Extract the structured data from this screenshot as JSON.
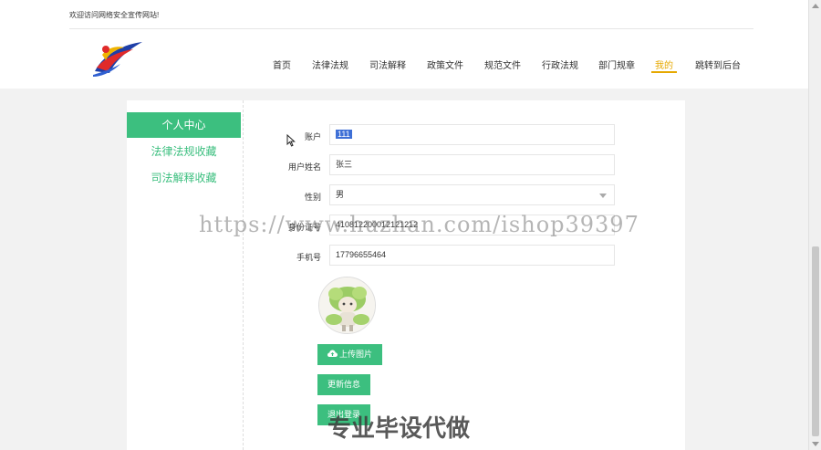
{
  "header": {
    "welcome": "欢迎访问网络安全宣传网站!"
  },
  "nav": {
    "items": [
      {
        "label": "首页"
      },
      {
        "label": "法律法规"
      },
      {
        "label": "司法解释"
      },
      {
        "label": "政策文件"
      },
      {
        "label": "规范文件"
      },
      {
        "label": "行政法规"
      },
      {
        "label": "部门规章"
      },
      {
        "label": "我的"
      },
      {
        "label": "跳转到后台"
      }
    ],
    "active_index": 7
  },
  "sidebar": {
    "title": "个人中心",
    "links": [
      {
        "label": "法律法规收藏"
      },
      {
        "label": "司法解释收藏"
      }
    ]
  },
  "form": {
    "account": {
      "label": "账户",
      "value": "111"
    },
    "username": {
      "label": "用户姓名",
      "value": "张三"
    },
    "gender": {
      "label": "性别",
      "value": "男"
    },
    "id_card": {
      "label": "身份证号",
      "value": "410812200012121212"
    },
    "phone": {
      "label": "手机号",
      "value": "17796655464"
    }
  },
  "buttons": {
    "upload": "上传图片",
    "update": "更新信息",
    "logout": "退出登录"
  },
  "watermarks": {
    "url": "https://www.huzhan.com/ishop39397",
    "text": "专业毕设代做"
  },
  "colors": {
    "primary": "#3cbf7f",
    "active_nav": "#e6a800",
    "selection": "#3e6fd6"
  }
}
